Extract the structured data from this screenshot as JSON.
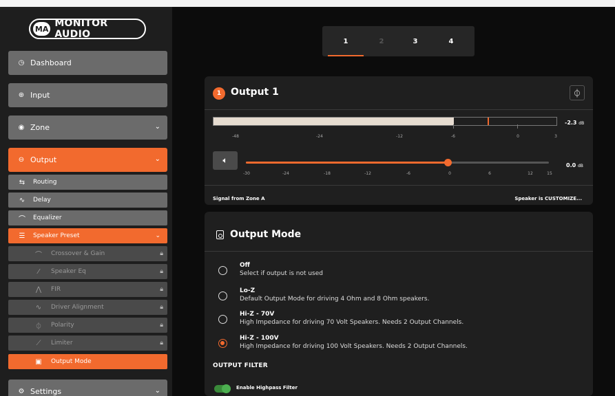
{
  "brand": {
    "logo_mark": "MA",
    "name": "MONITOR AUDIO"
  },
  "sidebar": {
    "dashboard": "Dashboard",
    "input": "Input",
    "zone": "Zone",
    "output": "Output",
    "output_sub": [
      "Routing",
      "Delay",
      "Equalizer",
      "Speaker Preset"
    ],
    "preset_sub": [
      "Crossover & Gain",
      "Speaker Eq",
      "FIR",
      "Driver Alignment",
      "Polarity",
      "Limiter",
      "Output Mode"
    ],
    "settings": "Settings"
  },
  "tabs": [
    "1",
    "2",
    "3",
    "4"
  ],
  "output_card": {
    "badge": "1",
    "title": "Output 1",
    "meter": {
      "labels": [
        "-48",
        "-24",
        "-12",
        "-6",
        "0",
        "3"
      ],
      "value": "-2.3",
      "unit": "dB",
      "level_fraction": 0.7,
      "peak_fraction": 0.8
    },
    "volume": {
      "labels": [
        "-30",
        "-24",
        "-18",
        "-12",
        "-6",
        "0",
        "6",
        "12",
        "15"
      ],
      "value": "0.0",
      "unit": "dB",
      "level_fraction": 0.667
    },
    "signal_text": "Signal from Zone A",
    "speaker_text": "Speaker is CUSTOMIZE..."
  },
  "mode_card": {
    "title": "Output Mode",
    "options": [
      {
        "title": "Off",
        "desc": "Select if output is not used"
      },
      {
        "title": "Lo-Z",
        "desc": "Default Output Mode for driving 4 Ohm and 8 Ohm speakers."
      },
      {
        "title": "Hi-Z - 70V",
        "desc": "High Impedance for driving 70 Volt Speakers. Needs 2 Output Channels."
      },
      {
        "title": "Hi-Z - 100V",
        "desc": "High Impedance for driving 100 Volt Speakers. Needs 2 Output Channels."
      }
    ],
    "selected_option": "Hi-Z - 100V",
    "filter_heading": "OUTPUT FILTER",
    "highpass_label": "Enable Highpass Filter",
    "highpass_enabled": true
  },
  "colors": {
    "accent": "#f26a2e",
    "toggle_on": "#4caf50"
  }
}
